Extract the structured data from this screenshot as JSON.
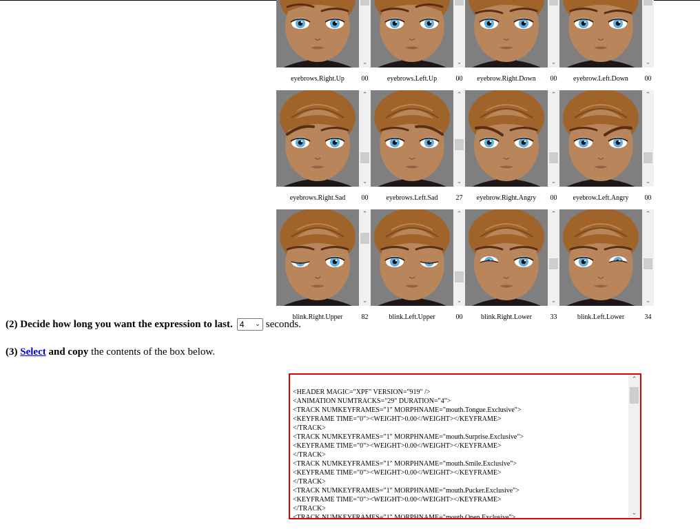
{
  "morph_rows": [
    {
      "cells": [
        {
          "name": "eyebrows.Right.Up",
          "value": "00",
          "brow": "up-right",
          "blink": "none",
          "thumb": 0.2
        },
        {
          "name": "eyebrows.Left.Up",
          "value": "00",
          "brow": "up-left",
          "blink": "none",
          "thumb": 0.2
        },
        {
          "name": "eyebrow.Right.Down",
          "value": "00",
          "brow": "down-right",
          "blink": "none",
          "thumb": 0.2
        },
        {
          "name": "eyebrow.Left.Down",
          "value": "00",
          "brow": "down-left",
          "blink": "none",
          "thumb": 0.2
        }
      ]
    },
    {
      "cells": [
        {
          "name": "eyebrows.Right.Sad",
          "value": "00",
          "brow": "sad-right",
          "blink": "none",
          "thumb": 0.8
        },
        {
          "name": "eyebrows.Left.Sad",
          "value": "27",
          "brow": "sad-left",
          "blink": "none",
          "thumb": 0.6
        },
        {
          "name": "eyebrow.Right.Angry",
          "value": "00",
          "brow": "angry-right",
          "blink": "none",
          "thumb": 0.8
        },
        {
          "name": "eyebrow.Left.Angry",
          "value": "00",
          "brow": "angry-left",
          "blink": "none",
          "thumb": 0.8
        }
      ]
    },
    {
      "cells": [
        {
          "name": "blink.Right.Upper",
          "value": "82",
          "brow": "neutral",
          "blink": "upper-right",
          "thumb": 0.2
        },
        {
          "name": "blink.Left.Upper",
          "value": "00",
          "brow": "neutral",
          "blink": "upper-left",
          "thumb": 0.8
        },
        {
          "name": "blink.Right.Lower",
          "value": "33",
          "brow": "neutral",
          "blink": "lower-right",
          "thumb": 0.6
        },
        {
          "name": "blink.Left.Lower",
          "value": "34",
          "brow": "neutral",
          "blink": "lower-left",
          "thumb": 0.6
        }
      ]
    }
  ],
  "step2": {
    "prefix": "(2) Decide how long you want the expression to last.",
    "duration": "4",
    "suffix": "seconds."
  },
  "step3": {
    "prefix": "(3)",
    "link": "Select",
    "middle": "and copy",
    "suffix": "the contents of the box below."
  },
  "xml_lines": [
    "<HEADER MAGIC=\"XPF\" VERSION=\"919\" />",
    "<ANIMATION NUMTRACKS=\"29\" DURATION=\"4\">",
    "<TRACK NUMKEYFRAMES=\"1\" MORPHNAME=\"mouth.Tongue.Exclusive\">",
    "<KEYFRAME TIME=\"0\"><WEIGHT>0.00</WEIGHT></KEYFRAME>",
    "</TRACK>",
    "<TRACK NUMKEYFRAMES=\"1\" MORPHNAME=\"mouth.Surprise.Exclusive\">",
    "<KEYFRAME TIME=\"0\"><WEIGHT>0.00</WEIGHT></KEYFRAME>",
    "</TRACK>",
    "<TRACK NUMKEYFRAMES=\"1\" MORPHNAME=\"mouth.Smile.Exclusive\">",
    "<KEYFRAME TIME=\"0\"><WEIGHT>0.00</WEIGHT></KEYFRAME>",
    "</TRACK>",
    "<TRACK NUMKEYFRAMES=\"1\" MORPHNAME=\"mouth.Pucker.Exclusive\">",
    "<KEYFRAME TIME=\"0\"><WEIGHT>0.00</WEIGHT></KEYFRAME>",
    "</TRACK>",
    "<TRACK NUMKEYFRAMES=\"1\" MORPHNAME=\"mouth.Open.Exclusive\">"
  ],
  "colors": {
    "frame": "#e00000",
    "link": "#0000ee",
    "skin": "#b9855a",
    "hair": "#a0642a",
    "iris": "#5fb0e0",
    "bg": "#7f7f7f"
  }
}
